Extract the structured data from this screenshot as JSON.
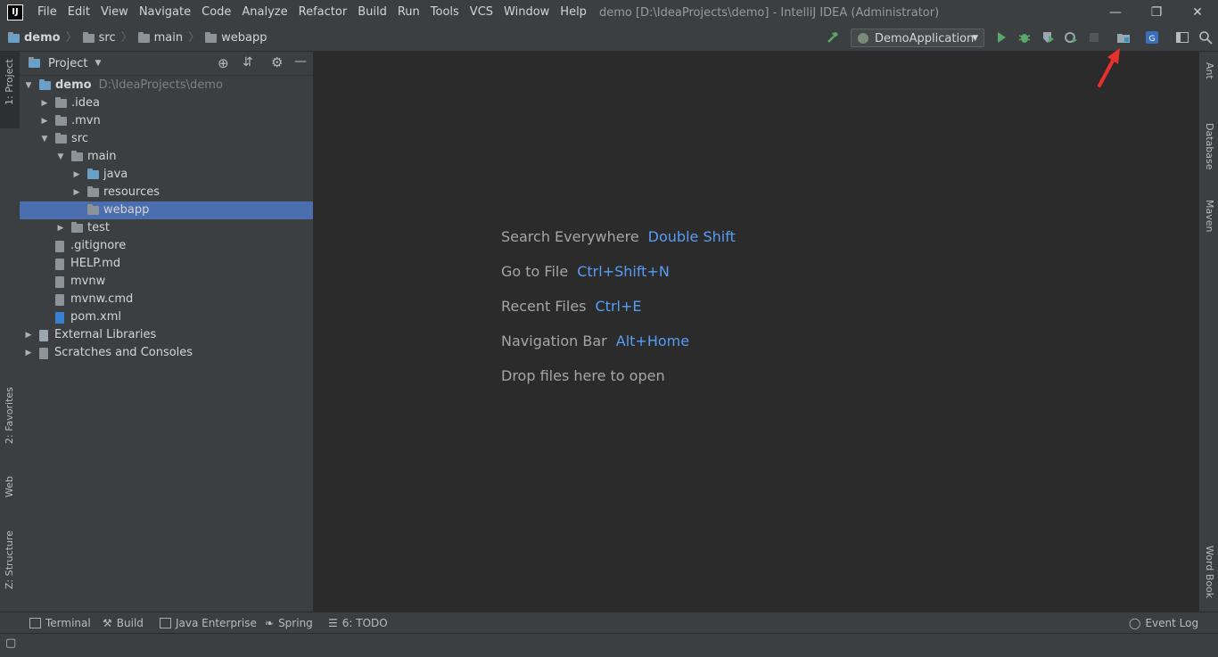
{
  "titlebar": {
    "menu": [
      "File",
      "Edit",
      "View",
      "Navigate",
      "Code",
      "Analyze",
      "Refactor",
      "Build",
      "Run",
      "Tools",
      "VCS",
      "Window",
      "Help"
    ],
    "window_title": "demo [D:\\IdeaProjects\\demo] - IntelliJ IDEA (Administrator)",
    "minimize": "—",
    "restore": "❐",
    "close": "✕"
  },
  "navbar": {
    "breadcrumbs": [
      "demo",
      "src",
      "main",
      "webapp"
    ],
    "run_config": "DemoApplication"
  },
  "left_strip": {
    "tabs": [
      "1: Project",
      "2: Favorites",
      "Web",
      "Z: Structure"
    ]
  },
  "project_panel": {
    "title": "Project",
    "tree": [
      {
        "label": "demo",
        "path": "D:\\IdeaProjects\\demo",
        "arrow": "▼",
        "icon": "module-folder-icon"
      },
      {
        "label": ".idea",
        "arrow": "▶",
        "icon": "folder-icon"
      },
      {
        "label": ".mvn",
        "arrow": "▶",
        "icon": "folder-icon"
      },
      {
        "label": "src",
        "arrow": "▼",
        "icon": "folder-icon"
      },
      {
        "label": "main",
        "arrow": "▼",
        "icon": "folder-icon"
      },
      {
        "label": "java",
        "arrow": "▶",
        "icon": "source-folder-icon"
      },
      {
        "label": "resources",
        "arrow": "▶",
        "icon": "resources-folder-icon"
      },
      {
        "label": "webapp",
        "arrow": "",
        "icon": "folder-icon",
        "selected": true
      },
      {
        "label": "test",
        "arrow": "▶",
        "icon": "folder-icon"
      },
      {
        "label": ".gitignore",
        "arrow": "",
        "icon": "text-file-icon"
      },
      {
        "label": "HELP.md",
        "arrow": "",
        "icon": "markdown-file-icon"
      },
      {
        "label": "mvnw",
        "arrow": "",
        "icon": "shell-file-icon"
      },
      {
        "label": "mvnw.cmd",
        "arrow": "",
        "icon": "text-file-icon"
      },
      {
        "label": "pom.xml",
        "arrow": "",
        "icon": "maven-file-icon"
      },
      {
        "label": "External Libraries",
        "arrow": "▶",
        "icon": "libraries-icon"
      },
      {
        "label": "Scratches and Consoles",
        "arrow": "▶",
        "icon": "scratches-icon"
      }
    ]
  },
  "editor": {
    "hints": [
      {
        "label": "Search Everywhere",
        "key": "Double Shift"
      },
      {
        "label": "Go to File",
        "key": "Ctrl+Shift+N"
      },
      {
        "label": "Recent Files",
        "key": "Ctrl+E"
      },
      {
        "label": "Navigation Bar",
        "key": "Alt+Home"
      },
      {
        "label": "Drop files here to open",
        "key": ""
      }
    ]
  },
  "right_strip": {
    "tabs": [
      "Ant",
      "Database",
      "Maven",
      "Word Book"
    ]
  },
  "bottom_bar": {
    "tabs": [
      "Terminal",
      "Build",
      "Java Enterprise",
      "Spring",
      "6: TODO"
    ],
    "event_log": "Event Log"
  },
  "colors": {
    "accent": "#589df6",
    "selection": "#4b6eaf",
    "annotation_arrow": "#e8312c"
  }
}
